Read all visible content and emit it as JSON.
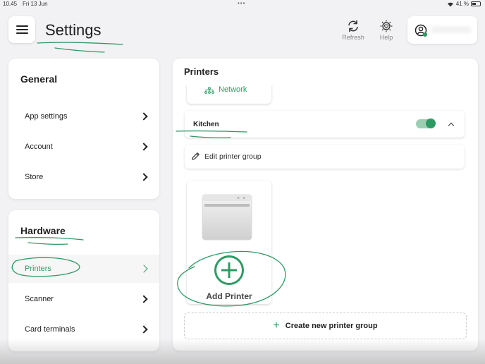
{
  "status_bar": {
    "time": "10.45",
    "date": "Fri 13 Jun",
    "battery": "41 %"
  },
  "header": {
    "title": "Settings",
    "refresh_label": "Refresh",
    "help_label": "Help"
  },
  "general": {
    "title": "General",
    "items": [
      {
        "label": "App settings"
      },
      {
        "label": "Account"
      },
      {
        "label": "Store"
      }
    ]
  },
  "hardware": {
    "title": "Hardware",
    "items": [
      {
        "label": "Printers",
        "active": true
      },
      {
        "label": "Scanner"
      },
      {
        "label": "Card terminals"
      }
    ]
  },
  "printers": {
    "title": "Printers",
    "network_label": "Network",
    "group": {
      "name": "Kitchen",
      "enabled": true
    },
    "edit_group_label": "Edit printer group",
    "add_printer_label": "Add Printer",
    "create_group_label": "Create new printer group"
  },
  "colors": {
    "accent": "#2e9a63",
    "background": "#f2f2f4"
  }
}
